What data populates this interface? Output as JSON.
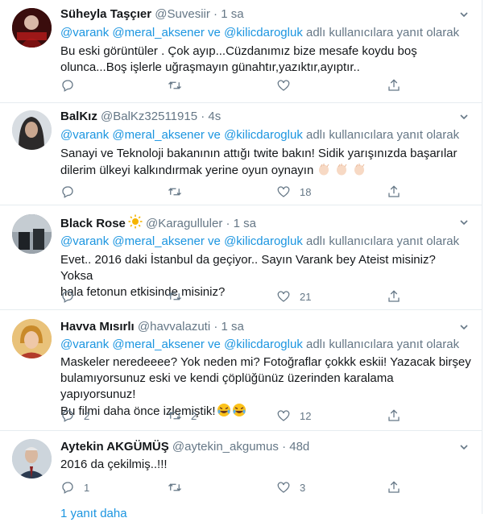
{
  "reply_prefix": "adlı kullanıcılara yanıt olarak",
  "colors": {
    "link": "#1b95e0",
    "meta": "#657786",
    "text": "#14171a",
    "divider": "#e6ecf0"
  },
  "tweets": [
    {
      "name": "Süheyla Taşçıer",
      "handle": "@Suvesiir",
      "time": "1 sa",
      "mentions": [
        "@varank",
        "@meral_aksener",
        "@kilicdarogluk"
      ],
      "mention_joiner": "ve",
      "text": [
        "Bu eski görüntüler . Çok ayıp...Cüzdanımız bize mesafe koydu boş",
        "olunca...Boş işlerle uğraşmayın günahtır,yazıktır,ayıptır.."
      ],
      "replies": "",
      "retweets": "",
      "likes": ""
    },
    {
      "name": "BalKız",
      "handle": "@BalKz32511915",
      "time": "4s",
      "mentions": [
        "@varank",
        "@meral_aksener",
        "@kilicdarogluk"
      ],
      "mention_joiner": "ve",
      "text": [
        "Sanayi ve Teknoloji bakanının attığı twite bakın! Sidik yarışınızda başarılar",
        "dilerim ülkeyi kalkındırmak yerine oyun oynayın"
      ],
      "replies": "",
      "retweets": "",
      "likes": "18"
    },
    {
      "name": "Black Rose",
      "handle": "@Karagulluler",
      "time": "1 sa",
      "mentions": [
        "@varank",
        "@meral_aksener",
        "@kilicdarogluk"
      ],
      "mention_joiner": "ve",
      "text": [
        "Evet.. 2016 daki İstanbul da geçiyor.. Sayın Varank bey Ateist misiniz? Yoksa",
        "hala fetonun etkisinde misiniz?"
      ],
      "replies": "",
      "retweets": "",
      "likes": "21"
    },
    {
      "name": "Havva Mısırlı",
      "handle": "@havvalazuti",
      "time": "1 sa",
      "mentions": [
        "@varank",
        "@meral_aksener",
        "@kilicdarogluk"
      ],
      "mention_joiner": "ve",
      "text": [
        "Maskeler neredeeee? Yok neden mi? Fotoğraflar çokkk eskii!  Yazacak birşey",
        "bulamıyorsunuz eski ve kendi çöplüğünüz üzerinden karalama yapıyorsunuz!",
        "Bu filmi daha önce izlemiştik!"
      ],
      "replies": "2",
      "retweets": "2",
      "likes": "12"
    },
    {
      "name": "Aytekin AKGÜMÜŞ",
      "handle": "@aytekin_akgumus",
      "time": "48d",
      "mentions": [],
      "mention_joiner": "",
      "text": [
        "2016 da çekilmiş..!!!"
      ],
      "replies": "1",
      "retweets": "",
      "likes": "3"
    }
  ],
  "show_more": "1 yanıt daha"
}
